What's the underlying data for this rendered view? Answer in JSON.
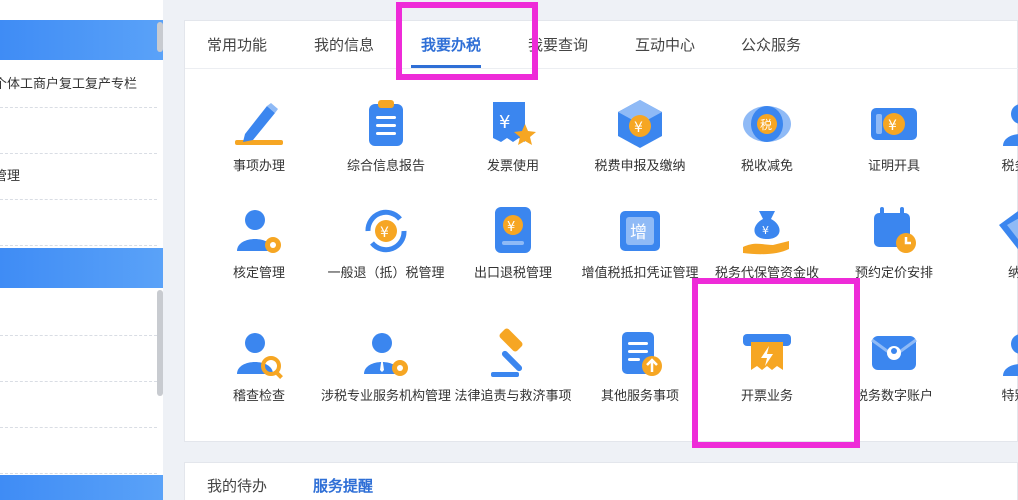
{
  "sidebar": {
    "items": [
      {
        "label": "个体工商户复工复产专栏"
      },
      {
        "label": ""
      },
      {
        "label": "管理"
      },
      {
        "label": ""
      }
    ]
  },
  "tabs": [
    {
      "label": "常用功能"
    },
    {
      "label": "我的信息"
    },
    {
      "label": "我要办税"
    },
    {
      "label": "我要查询"
    },
    {
      "label": "互动中心"
    },
    {
      "label": "公众服务"
    }
  ],
  "grid": [
    {
      "label": "事项办理",
      "icon": "pencil-icon"
    },
    {
      "label": "综合信息报告",
      "icon": "clipboard-icon"
    },
    {
      "label": "发票使用",
      "icon": "invoice-star-icon"
    },
    {
      "label": "税费申报及缴纳",
      "icon": "box-yuan-icon"
    },
    {
      "label": "税收减免",
      "icon": "tax-coin-icon"
    },
    {
      "label": "证明开具",
      "icon": "ticket-yuan-icon"
    },
    {
      "label": "税务行",
      "icon": "person-icon"
    },
    {
      "label": "核定管理",
      "icon": "user-gear-icon"
    },
    {
      "label": "一般退（抵）税管理",
      "icon": "refund-yuan-icon"
    },
    {
      "label": "出口退税管理",
      "icon": "export-yuan-icon"
    },
    {
      "label": "增值税抵扣凭证管理",
      "icon": "vat-ticket-icon"
    },
    {
      "label": "税务代保管资金收",
      "icon": "money-bag-hand-icon"
    },
    {
      "label": "预约定价安排",
      "icon": "calendar-clock-icon"
    },
    {
      "label": "纳税",
      "icon": "diamond-icon"
    },
    {
      "label": "稽查检查",
      "icon": "inspector-icon"
    },
    {
      "label": "涉税专业服务机构管理",
      "icon": "agent-gear-icon"
    },
    {
      "label": "法律追责与救济事项",
      "icon": "gavel-icon"
    },
    {
      "label": "其他服务事项",
      "icon": "document-upload-icon"
    },
    {
      "label": "开票业务",
      "icon": "invoice-printer-icon"
    },
    {
      "label": "税务数字账户",
      "icon": "digital-account-icon"
    },
    {
      "label": "特别纳",
      "icon": "person-icon"
    }
  ],
  "bottom_tabs": [
    {
      "label": "我的待办"
    },
    {
      "label": "服务提醒"
    }
  ],
  "colors": {
    "accent": "#2f6fd6",
    "highlight": "#ee2bd8",
    "icon_blue": "#3b86ef",
    "icon_orange": "#f6a623"
  }
}
